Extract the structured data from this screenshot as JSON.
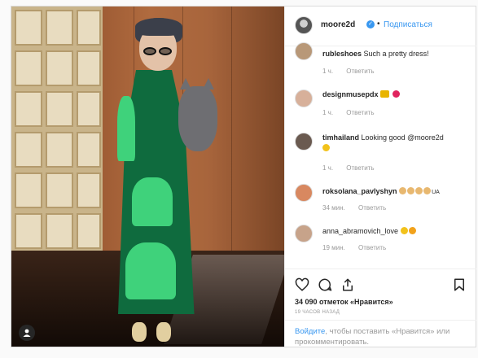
{
  "header": {
    "username": "moore2d",
    "separator": "•",
    "follow_label": "Подписаться"
  },
  "comments": [
    {
      "username": "rubleshoes",
      "text": "Such a pretty dress!",
      "time": "1 ч.",
      "reply": "Ответить"
    },
    {
      "username": "designmusepdx",
      "text": "",
      "time": "1 ч.",
      "reply": "Ответить"
    },
    {
      "username": "timhailand",
      "text": "Looking good @moore2d",
      "time": "1 ч.",
      "reply": "Ответить"
    },
    {
      "username": "roksolana_pavlyshyn",
      "text": "UA",
      "time": "34 мин.",
      "reply": "Ответить"
    },
    {
      "username": "anna_abramovich_love",
      "text": "",
      "time": "19 мин.",
      "reply": "Ответить"
    }
  ],
  "footer": {
    "likes": "34 090 отметок «Нравится»",
    "posted": "19 ЧАСОВ НАЗАД",
    "login_link": "Войдите",
    "login_rest": ", чтобы поставить «Нравится» или прокомментировать."
  },
  "icons": {
    "verified": "verified-badge-icon",
    "like": "heart-icon",
    "comment": "comment-bubble-icon",
    "share": "share-icon",
    "save": "bookmark-icon",
    "user_tag": "user-tag-icon"
  },
  "colors": {
    "link": "#3897f0",
    "text": "#262626",
    "muted": "#999999",
    "border": "#dbdbdb"
  }
}
